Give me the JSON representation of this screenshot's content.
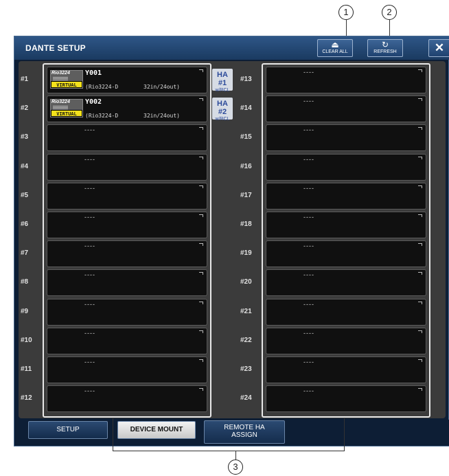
{
  "callouts": [
    "1",
    "2",
    "3"
  ],
  "window": {
    "title": "DANTE SETUP"
  },
  "toolbar": {
    "clear_all_label": "CLEAR ALL",
    "refresh_label": "REFRESH",
    "close_label": "✕"
  },
  "slots_left": [
    {
      "num": "#1",
      "name": "Y001",
      "model": "(Rio3224-D",
      "io": "32in/24out)",
      "unit_label": "Rio3224",
      "badge": "VIRTUAL"
    },
    {
      "num": "#2",
      "name": "Y002",
      "model": "(Rio3224-D",
      "io": "32in/24out)",
      "unit_label": "Rio3224",
      "badge": "VIRTUAL"
    },
    {
      "num": "#3",
      "dash": "----"
    },
    {
      "num": "#4",
      "dash": "----"
    },
    {
      "num": "#5",
      "dash": "----"
    },
    {
      "num": "#6",
      "dash": "----"
    },
    {
      "num": "#7",
      "dash": "----"
    },
    {
      "num": "#8",
      "dash": "----"
    },
    {
      "num": "#9",
      "dash": "----"
    },
    {
      "num": "#10",
      "dash": "----"
    },
    {
      "num": "#11",
      "dash": "----"
    },
    {
      "num": "#12",
      "dash": "----"
    }
  ],
  "slots_right": [
    {
      "num": "#13",
      "dash": "----"
    },
    {
      "num": "#14",
      "dash": "----"
    },
    {
      "num": "#15",
      "dash": "----"
    },
    {
      "num": "#16",
      "dash": "----"
    },
    {
      "num": "#17",
      "dash": "----"
    },
    {
      "num": "#18",
      "dash": "----"
    },
    {
      "num": "#19",
      "dash": "----"
    },
    {
      "num": "#20",
      "dash": "----"
    },
    {
      "num": "#21",
      "dash": "----"
    },
    {
      "num": "#22",
      "dash": "----"
    },
    {
      "num": "#23",
      "dash": "----"
    },
    {
      "num": "#24",
      "dash": "----"
    }
  ],
  "ha_badges": [
    {
      "line1": "HA #1",
      "line2": "w/RCL"
    },
    {
      "line1": "HA #2",
      "line2": "w/RCL"
    }
  ],
  "tabs": [
    {
      "label": "SETUP",
      "active": false
    },
    {
      "label": "DEVICE MOUNT",
      "active": true
    },
    {
      "label_line1": "REMOTE HA",
      "label_line2": "ASSIGN",
      "active": false
    }
  ],
  "icons": {
    "clear_all": "eject-icon",
    "refresh": "refresh-icon",
    "close": "close-icon",
    "slot_corner": "popup-corner-icon"
  },
  "colors": {
    "window_bg": "#0d1e35",
    "titlebar": "#2e5687",
    "content_bg": "#3b3b3b",
    "slot_bg": "#101010",
    "virtual_badge": "#f4e21c",
    "ha_badge": "#d7dce5",
    "ha_text": "#2c4a9a"
  }
}
